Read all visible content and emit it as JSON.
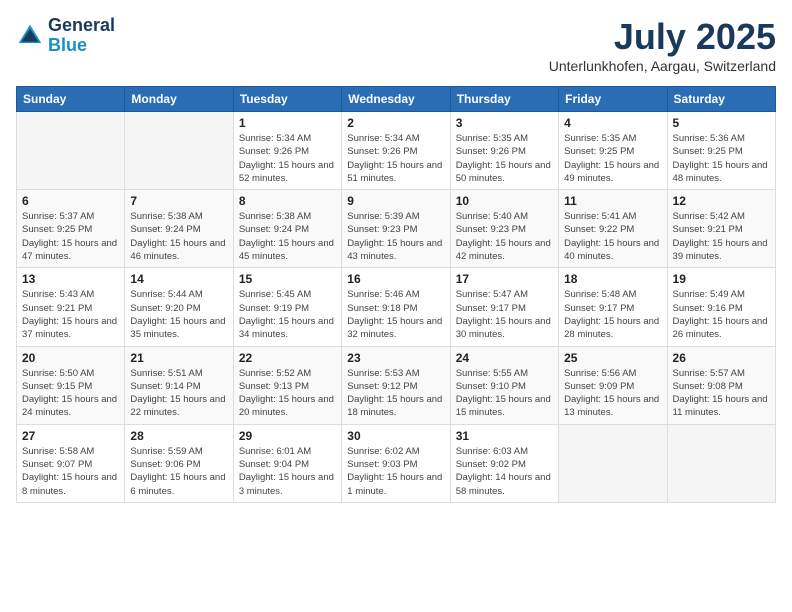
{
  "logo": {
    "line1": "General",
    "line2": "Blue"
  },
  "title": "July 2025",
  "subtitle": "Unterlunkhofen, Aargau, Switzerland",
  "weekdays": [
    "Sunday",
    "Monday",
    "Tuesday",
    "Wednesday",
    "Thursday",
    "Friday",
    "Saturday"
  ],
  "weeks": [
    [
      {
        "day": "",
        "info": ""
      },
      {
        "day": "",
        "info": ""
      },
      {
        "day": "1",
        "info": "Sunrise: 5:34 AM\nSunset: 9:26 PM\nDaylight: 15 hours and 52 minutes."
      },
      {
        "day": "2",
        "info": "Sunrise: 5:34 AM\nSunset: 9:26 PM\nDaylight: 15 hours and 51 minutes."
      },
      {
        "day": "3",
        "info": "Sunrise: 5:35 AM\nSunset: 9:26 PM\nDaylight: 15 hours and 50 minutes."
      },
      {
        "day": "4",
        "info": "Sunrise: 5:35 AM\nSunset: 9:25 PM\nDaylight: 15 hours and 49 minutes."
      },
      {
        "day": "5",
        "info": "Sunrise: 5:36 AM\nSunset: 9:25 PM\nDaylight: 15 hours and 48 minutes."
      }
    ],
    [
      {
        "day": "6",
        "info": "Sunrise: 5:37 AM\nSunset: 9:25 PM\nDaylight: 15 hours and 47 minutes."
      },
      {
        "day": "7",
        "info": "Sunrise: 5:38 AM\nSunset: 9:24 PM\nDaylight: 15 hours and 46 minutes."
      },
      {
        "day": "8",
        "info": "Sunrise: 5:38 AM\nSunset: 9:24 PM\nDaylight: 15 hours and 45 minutes."
      },
      {
        "day": "9",
        "info": "Sunrise: 5:39 AM\nSunset: 9:23 PM\nDaylight: 15 hours and 43 minutes."
      },
      {
        "day": "10",
        "info": "Sunrise: 5:40 AM\nSunset: 9:23 PM\nDaylight: 15 hours and 42 minutes."
      },
      {
        "day": "11",
        "info": "Sunrise: 5:41 AM\nSunset: 9:22 PM\nDaylight: 15 hours and 40 minutes."
      },
      {
        "day": "12",
        "info": "Sunrise: 5:42 AM\nSunset: 9:21 PM\nDaylight: 15 hours and 39 minutes."
      }
    ],
    [
      {
        "day": "13",
        "info": "Sunrise: 5:43 AM\nSunset: 9:21 PM\nDaylight: 15 hours and 37 minutes."
      },
      {
        "day": "14",
        "info": "Sunrise: 5:44 AM\nSunset: 9:20 PM\nDaylight: 15 hours and 35 minutes."
      },
      {
        "day": "15",
        "info": "Sunrise: 5:45 AM\nSunset: 9:19 PM\nDaylight: 15 hours and 34 minutes."
      },
      {
        "day": "16",
        "info": "Sunrise: 5:46 AM\nSunset: 9:18 PM\nDaylight: 15 hours and 32 minutes."
      },
      {
        "day": "17",
        "info": "Sunrise: 5:47 AM\nSunset: 9:17 PM\nDaylight: 15 hours and 30 minutes."
      },
      {
        "day": "18",
        "info": "Sunrise: 5:48 AM\nSunset: 9:17 PM\nDaylight: 15 hours and 28 minutes."
      },
      {
        "day": "19",
        "info": "Sunrise: 5:49 AM\nSunset: 9:16 PM\nDaylight: 15 hours and 26 minutes."
      }
    ],
    [
      {
        "day": "20",
        "info": "Sunrise: 5:50 AM\nSunset: 9:15 PM\nDaylight: 15 hours and 24 minutes."
      },
      {
        "day": "21",
        "info": "Sunrise: 5:51 AM\nSunset: 9:14 PM\nDaylight: 15 hours and 22 minutes."
      },
      {
        "day": "22",
        "info": "Sunrise: 5:52 AM\nSunset: 9:13 PM\nDaylight: 15 hours and 20 minutes."
      },
      {
        "day": "23",
        "info": "Sunrise: 5:53 AM\nSunset: 9:12 PM\nDaylight: 15 hours and 18 minutes."
      },
      {
        "day": "24",
        "info": "Sunrise: 5:55 AM\nSunset: 9:10 PM\nDaylight: 15 hours and 15 minutes."
      },
      {
        "day": "25",
        "info": "Sunrise: 5:56 AM\nSunset: 9:09 PM\nDaylight: 15 hours and 13 minutes."
      },
      {
        "day": "26",
        "info": "Sunrise: 5:57 AM\nSunset: 9:08 PM\nDaylight: 15 hours and 11 minutes."
      }
    ],
    [
      {
        "day": "27",
        "info": "Sunrise: 5:58 AM\nSunset: 9:07 PM\nDaylight: 15 hours and 8 minutes."
      },
      {
        "day": "28",
        "info": "Sunrise: 5:59 AM\nSunset: 9:06 PM\nDaylight: 15 hours and 6 minutes."
      },
      {
        "day": "29",
        "info": "Sunrise: 6:01 AM\nSunset: 9:04 PM\nDaylight: 15 hours and 3 minutes."
      },
      {
        "day": "30",
        "info": "Sunrise: 6:02 AM\nSunset: 9:03 PM\nDaylight: 15 hours and 1 minute."
      },
      {
        "day": "31",
        "info": "Sunrise: 6:03 AM\nSunset: 9:02 PM\nDaylight: 14 hours and 58 minutes."
      },
      {
        "day": "",
        "info": ""
      },
      {
        "day": "",
        "info": ""
      }
    ]
  ]
}
